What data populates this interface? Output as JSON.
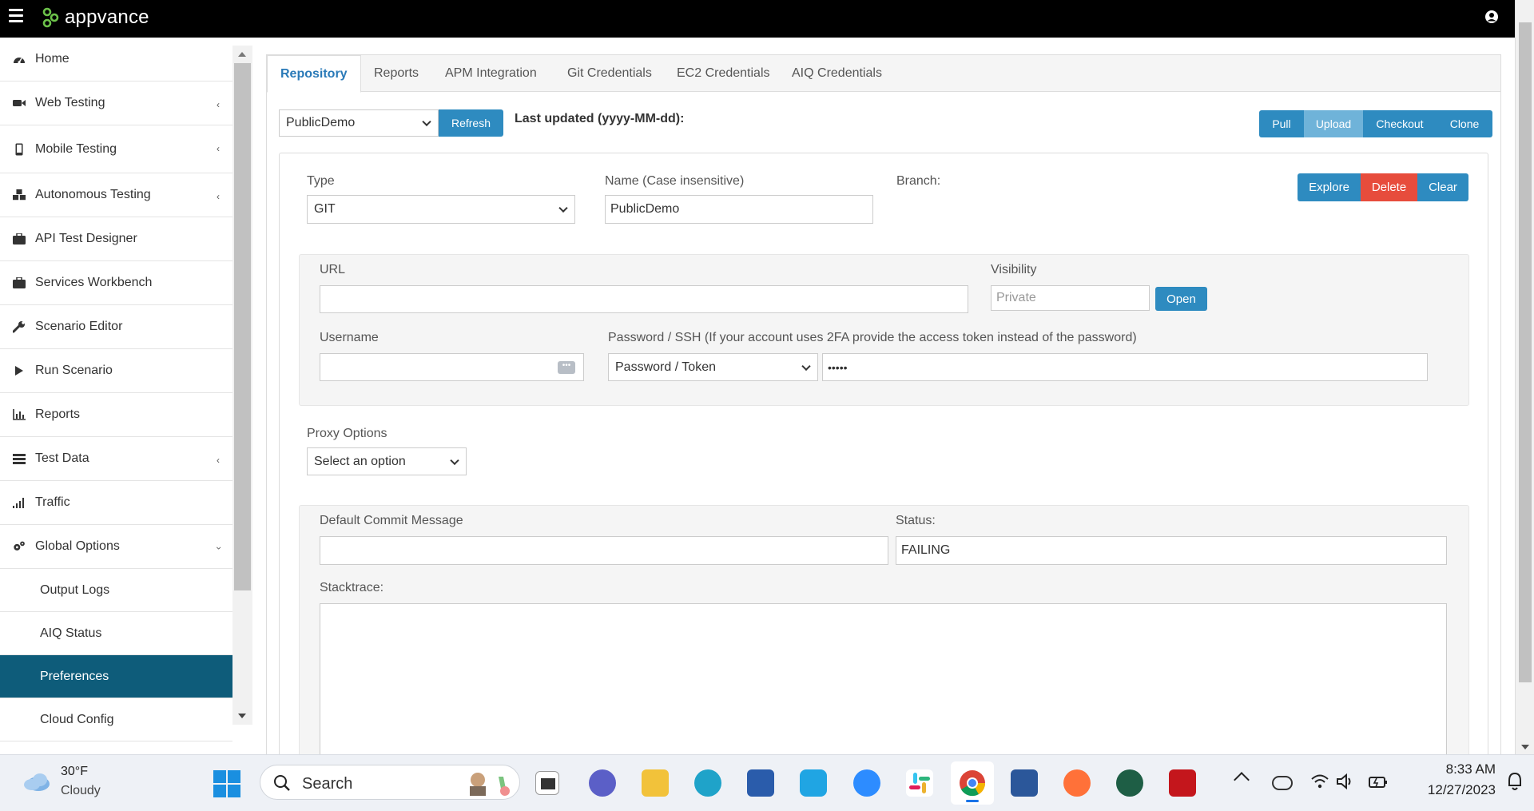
{
  "app": {
    "brand": "appvance"
  },
  "sidebar": {
    "items": [
      {
        "label": "Home",
        "icon": "dashboard-icon"
      },
      {
        "label": "Web Testing",
        "icon": "video-camera-icon"
      },
      {
        "label": "Mobile Testing",
        "icon": "mobile-phone-icon"
      },
      {
        "label": "Autonomous Testing",
        "icon": "cubes-icon"
      },
      {
        "label": "API Test Designer",
        "icon": "briefcase-icon"
      },
      {
        "label": "Services Workbench",
        "icon": "briefcase-icon"
      },
      {
        "label": "Scenario Editor",
        "icon": "wrench-icon"
      },
      {
        "label": "Run Scenario",
        "icon": "play-icon"
      },
      {
        "label": "Reports",
        "icon": "bar-chart-icon"
      },
      {
        "label": "Test Data",
        "icon": "table-icon"
      },
      {
        "label": "Traffic",
        "icon": "signal-icon"
      },
      {
        "label": "Global Options",
        "icon": "gears-icon"
      }
    ],
    "subitems": [
      {
        "label": "Output Logs"
      },
      {
        "label": "AIQ Status"
      },
      {
        "label": "Preferences"
      },
      {
        "label": "Cloud Config"
      }
    ]
  },
  "tabs": [
    "Repository",
    "Reports",
    "APM Integration",
    "Git Credentials",
    "EC2 Credentials",
    "AIQ Credentials"
  ],
  "repo": {
    "selected": "PublicDemo",
    "refresh_label": "Refresh",
    "last_updated": "Last updated (yyyy-MM-dd):",
    "pull_label": "Pull",
    "upload_label": "Upload",
    "checkout_label": "Checkout",
    "clone_label": "Clone"
  },
  "form": {
    "type_label": "Type",
    "type_value": "GIT",
    "name_label": "Name (Case insensitive)",
    "name_value": "PublicDemo",
    "branch_label": "Branch:",
    "explore_label": "Explore",
    "delete_label": "Delete",
    "clear_label": "Clear",
    "url_label": "URL",
    "url_value": "",
    "visibility_label": "Visibility",
    "visibility_placeholder": "Private",
    "open_label": "Open",
    "username_label": "Username",
    "username_value": "",
    "password_label": "Password / SSH (If your account uses 2FA provide the access token instead of the password)",
    "password_type": "Password / Token",
    "password_value": "•••••",
    "proxy_label": "Proxy Options",
    "proxy_value": "Select an option",
    "commit_label": "Default Commit Message",
    "commit_value": "",
    "status_label": "Status:",
    "status_value": "FAILING",
    "stacktrace_label": "Stacktrace:"
  },
  "taskbar": {
    "weather_temp": "30°F",
    "weather_desc": "Cloudy",
    "search_placeholder": "Search",
    "time": "8:33 AM",
    "date": "12/27/2023"
  }
}
